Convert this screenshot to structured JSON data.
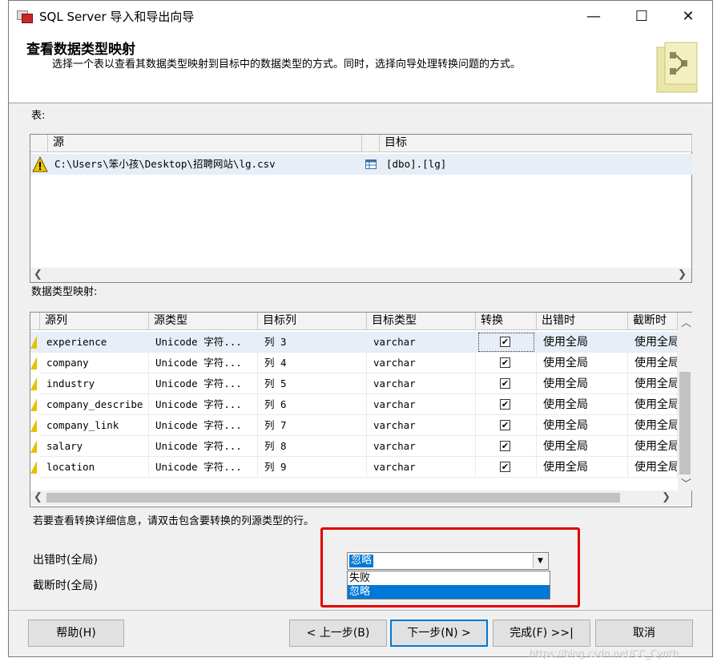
{
  "window": {
    "title": "SQL Server 导入和导出向导",
    "minimize": "—",
    "maximize": "☐",
    "close": "✕"
  },
  "header": {
    "title": "查看数据类型映射",
    "subtitle": "选择一个表以查看其数据类型映射到目标中的数据类型的方式。同时，选择向导处理转换问题的方式。"
  },
  "tables_label": "表:",
  "tables": {
    "columns": [
      "源",
      "目标"
    ],
    "rows": [
      {
        "source": "C:\\Users\\笨小孩\\Desktop\\招聘网站\\lg.csv",
        "target": "[dbo].[lg]"
      }
    ]
  },
  "mapping_label": "数据类型映射:",
  "mapping": {
    "columns": [
      "源列",
      "源类型",
      "目标列",
      "目标类型",
      "转换",
      "出错时",
      "截断时"
    ],
    "rows": [
      {
        "source_col": "experience",
        "source_type": "Unicode 字符...",
        "target_col": "列 3",
        "target_type": "varchar",
        "convert": "✔",
        "on_error": "使用全局",
        "on_trunc": "使用全局"
      },
      {
        "source_col": "company",
        "source_type": "Unicode 字符...",
        "target_col": "列 4",
        "target_type": "varchar",
        "convert": "✔",
        "on_error": "使用全局",
        "on_trunc": "使用全局"
      },
      {
        "source_col": "industry",
        "source_type": "Unicode 字符...",
        "target_col": "列 5",
        "target_type": "varchar",
        "convert": "✔",
        "on_error": "使用全局",
        "on_trunc": "使用全局"
      },
      {
        "source_col": "company_describe",
        "source_type": "Unicode 字符...",
        "target_col": "列 6",
        "target_type": "varchar",
        "convert": "✔",
        "on_error": "使用全局",
        "on_trunc": "使用全局"
      },
      {
        "source_col": "company_link",
        "source_type": "Unicode 字符...",
        "target_col": "列 7",
        "target_type": "varchar",
        "convert": "✔",
        "on_error": "使用全局",
        "on_trunc": "使用全局"
      },
      {
        "source_col": "salary",
        "source_type": "Unicode 字符...",
        "target_col": "列 8",
        "target_type": "varchar",
        "convert": "✔",
        "on_error": "使用全局",
        "on_trunc": "使用全局"
      },
      {
        "source_col": "location",
        "source_type": "Unicode 字符...",
        "target_col": "列 9",
        "target_type": "varchar",
        "convert": "✔",
        "on_error": "使用全局",
        "on_trunc": "使用全局"
      }
    ]
  },
  "hint": "若要查看转换详细信息，请双击包含要转换的列源类型的行。",
  "global_error_label": "出错时(全局)",
  "global_trunc_label": "截断时(全局)",
  "error_select": {
    "value": "忽略",
    "options": [
      "失败",
      "忽略"
    ]
  },
  "buttons": {
    "help": "帮助(H)",
    "back": "< 上一步(B)",
    "next": "下一步(N) >",
    "finish": "完成(F) >>|",
    "cancel": "取消"
  },
  "watermark": "https://blog.csdn.net/CC_Cynth",
  "colors": {
    "accent": "#0078d7",
    "highlight_box": "#e00000",
    "warning": "#e5c100"
  }
}
